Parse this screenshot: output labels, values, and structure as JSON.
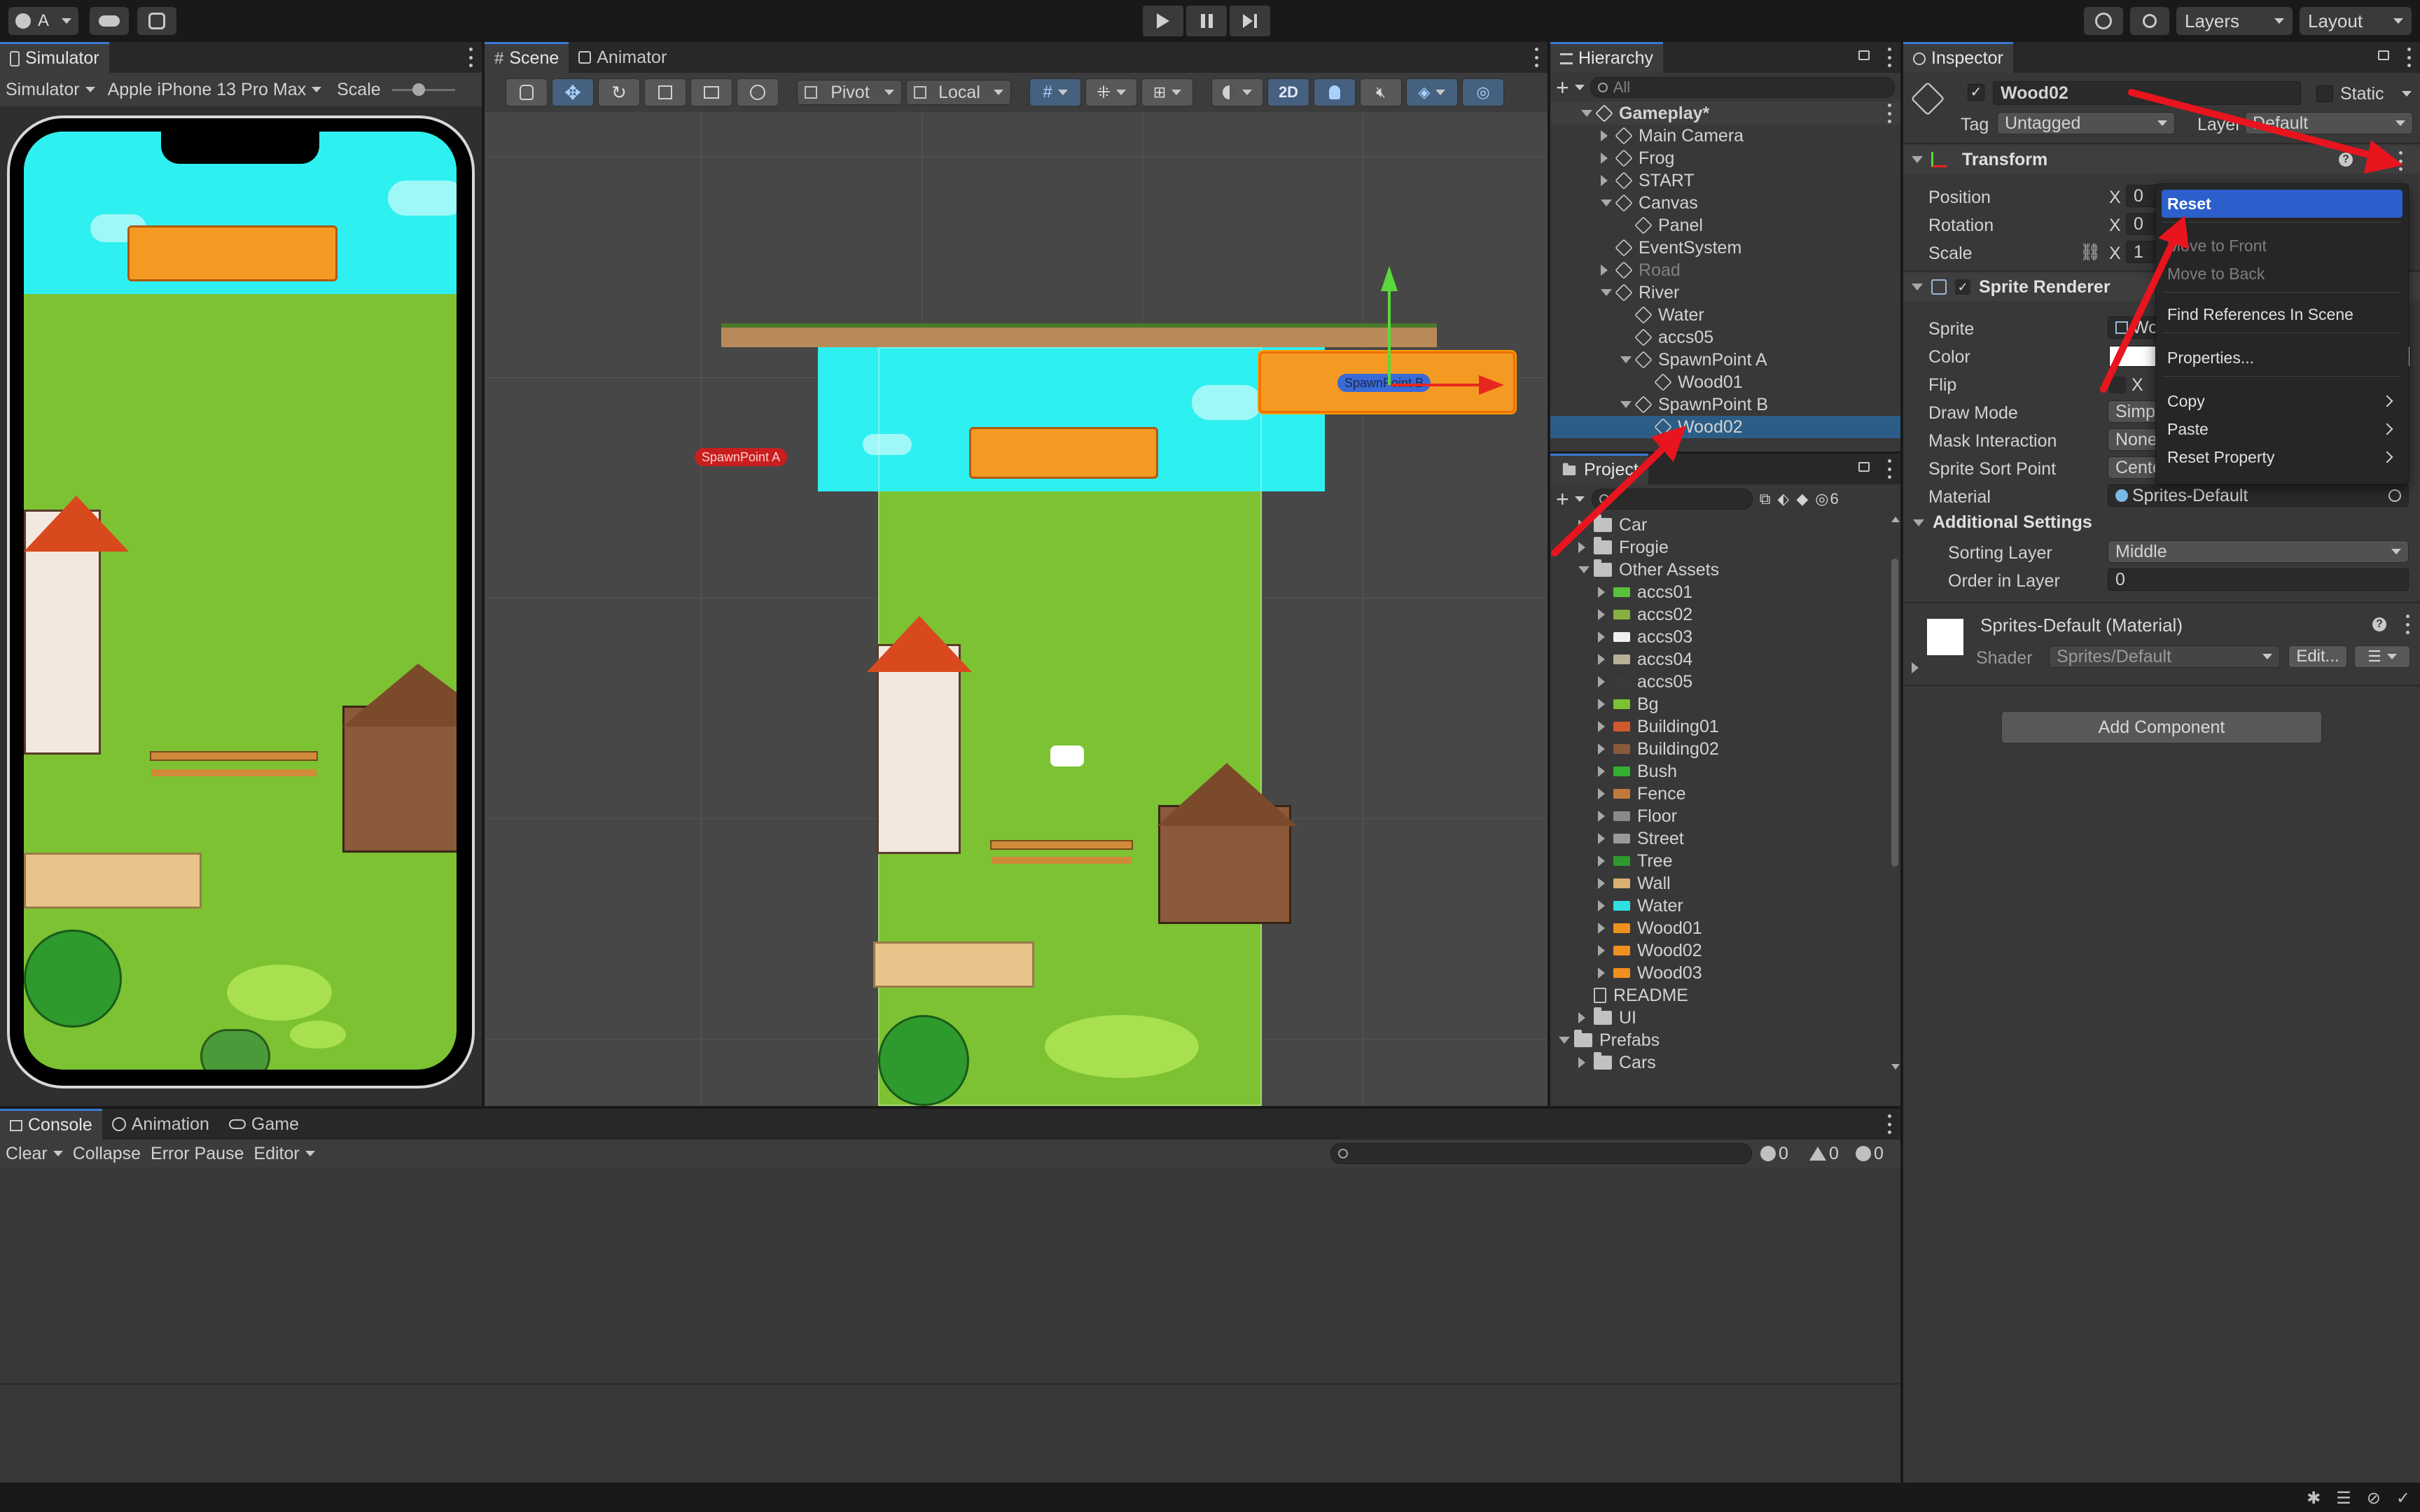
{
  "toolbar": {
    "account_label": "A",
    "layers_label": "Layers",
    "layout_label": "Layout"
  },
  "simulator": {
    "tab_label": "Simulator",
    "mode_label": "Simulator",
    "device_label": "Apple iPhone 13 Pro Max",
    "scale_label": "Scale",
    "scale_value": 0.4
  },
  "scene": {
    "tabs": [
      "Scene",
      "Animator"
    ],
    "pivot_label": "Pivot",
    "local_label": "Local",
    "mode_2d_label": "2D",
    "spawn_a_label": "SpawnPoint A",
    "spawn_b_label": "SpawnPoint B"
  },
  "hierarchy": {
    "tab_label": "Hierarchy",
    "search_placeholder": "All",
    "items": [
      {
        "label": "Gameplay*",
        "depth": 0,
        "expand": "open",
        "icon": "scene-icon",
        "bold": true
      },
      {
        "label": "Main Camera",
        "depth": 1,
        "expand": "closed",
        "icon": "gameobject-icon"
      },
      {
        "label": "Frog",
        "depth": 1,
        "expand": "closed",
        "icon": "gameobject-icon"
      },
      {
        "label": "START",
        "depth": 1,
        "expand": "closed",
        "icon": "gameobject-icon"
      },
      {
        "label": "Canvas",
        "depth": 1,
        "expand": "open",
        "icon": "gameobject-icon"
      },
      {
        "label": "Panel",
        "depth": 2,
        "expand": "none",
        "icon": "gameobject-icon"
      },
      {
        "label": "EventSystem",
        "depth": 1,
        "expand": "none",
        "icon": "gameobject-icon"
      },
      {
        "label": "Road",
        "depth": 1,
        "expand": "closed",
        "icon": "gameobject-icon",
        "dim": true
      },
      {
        "label": "River",
        "depth": 1,
        "expand": "open",
        "icon": "gameobject-icon"
      },
      {
        "label": "Water",
        "depth": 2,
        "expand": "none",
        "icon": "gameobject-icon"
      },
      {
        "label": "accs05",
        "depth": 2,
        "expand": "none",
        "icon": "gameobject-icon"
      },
      {
        "label": "SpawnPoint A",
        "depth": 2,
        "expand": "open",
        "icon": "gameobject-icon"
      },
      {
        "label": "Wood01",
        "depth": 3,
        "expand": "none",
        "icon": "gameobject-icon"
      },
      {
        "label": "SpawnPoint B",
        "depth": 2,
        "expand": "open",
        "icon": "gameobject-icon"
      },
      {
        "label": "Wood02",
        "depth": 3,
        "expand": "none",
        "icon": "gameobject-icon",
        "selected": true
      }
    ]
  },
  "project": {
    "tab_label": "Project",
    "badge_count": "6",
    "items": [
      {
        "label": "Car",
        "depth": 0,
        "expand": "closed",
        "icon": "folder-icon"
      },
      {
        "label": "Frogie",
        "depth": 0,
        "expand": "closed",
        "icon": "folder-icon"
      },
      {
        "label": "Other Assets",
        "depth": 0,
        "expand": "open",
        "icon": "folder-icon"
      },
      {
        "label": "accs01",
        "depth": 1,
        "expand": "closed",
        "icon": "accs01-sprite-icon",
        "color": "#57c23a"
      },
      {
        "label": "accs02",
        "depth": 1,
        "expand": "closed",
        "icon": "accs02-sprite-icon",
        "color": "#88b040"
      },
      {
        "label": "accs03",
        "depth": 1,
        "expand": "closed",
        "icon": "accs03-sprite-icon",
        "color": "#f0f0f0"
      },
      {
        "label": "accs04",
        "depth": 1,
        "expand": "closed",
        "icon": "accs04-sprite-icon",
        "color": "#b8b098"
      },
      {
        "label": "accs05",
        "depth": 1,
        "expand": "closed",
        "icon": "accs05-sprite-icon",
        "color": "#3a3a3a"
      },
      {
        "label": "Bg",
        "depth": 1,
        "expand": "closed",
        "icon": "bg-sprite-icon",
        "color": "#7cc232"
      },
      {
        "label": "Building01",
        "depth": 1,
        "expand": "closed",
        "icon": "building01-sprite-icon",
        "color": "#d05a2e"
      },
      {
        "label": "Building02",
        "depth": 1,
        "expand": "closed",
        "icon": "building02-sprite-icon",
        "color": "#8a5a3a"
      },
      {
        "label": "Bush",
        "depth": 1,
        "expand": "closed",
        "icon": "bush-sprite-icon",
        "color": "#34b030"
      },
      {
        "label": "Fence",
        "depth": 1,
        "expand": "closed",
        "icon": "fence-sprite-icon",
        "color": "#c07a3a"
      },
      {
        "label": "Floor",
        "depth": 1,
        "expand": "closed",
        "icon": "floor-sprite-icon",
        "color": "#8a8a8a"
      },
      {
        "label": "Street",
        "depth": 1,
        "expand": "closed",
        "icon": "street-sprite-icon",
        "color": "#9a9a9a"
      },
      {
        "label": "Tree",
        "depth": 1,
        "expand": "closed",
        "icon": "tree-sprite-icon",
        "color": "#2e9a2e"
      },
      {
        "label": "Wall",
        "depth": 1,
        "expand": "closed",
        "icon": "wall-sprite-icon",
        "color": "#d8b070"
      },
      {
        "label": "Water",
        "depth": 1,
        "expand": "closed",
        "icon": "water-sprite-icon",
        "color": "#2fe0e0"
      },
      {
        "label": "Wood01",
        "depth": 1,
        "expand": "closed",
        "icon": "wood01-sprite-icon",
        "color": "#f0901e"
      },
      {
        "label": "Wood02",
        "depth": 1,
        "expand": "closed",
        "icon": "wood02-sprite-icon",
        "color": "#f0901e"
      },
      {
        "label": "Wood03",
        "depth": 1,
        "expand": "closed",
        "icon": "wood03-sprite-icon",
        "color": "#f0901e"
      },
      {
        "label": "README",
        "depth": 0,
        "expand": "none",
        "icon": "readme-icon"
      },
      {
        "label": "UI",
        "depth": 0,
        "expand": "closed",
        "icon": "folder-icon"
      },
      {
        "label": "Prefabs",
        "depth": -1,
        "expand": "open",
        "icon": "folder-icon"
      },
      {
        "label": "Cars",
        "depth": 0,
        "expand": "closed",
        "icon": "folder-icon"
      }
    ]
  },
  "inspector": {
    "tab_label": "Inspector",
    "object_name": "Wood02",
    "static_label": "Static",
    "tag_label": "Tag",
    "tag_value": "Untagged",
    "layer_label": "Layer",
    "layer_value": "Default",
    "transform": {
      "title": "Transform",
      "position_label": "Position",
      "rotation_label": "Rotation",
      "scale_label": "Scale",
      "x_label": "X",
      "position_x": "0",
      "rotation_x": "0",
      "scale_x": "1"
    },
    "sprite_renderer": {
      "title": "Sprite Renderer",
      "sprite_label": "Sprite",
      "sprite_value": "Wo",
      "color_label": "Color",
      "flip_label": "Flip",
      "flip_x_label": "X",
      "draw_mode_label": "Draw Mode",
      "draw_mode_value": "Simp",
      "mask_label": "Mask Interaction",
      "mask_value": "None",
      "sort_point_label": "Sprite Sort Point",
      "sort_point_value": "Cente",
      "material_label": "Material",
      "material_value": "Sprites-Default"
    },
    "additional": {
      "title": "Additional Settings",
      "sorting_layer_label": "Sorting Layer",
      "sorting_layer_value": "Middle",
      "order_label": "Order in Layer",
      "order_value": "0"
    },
    "material": {
      "title": "Sprites-Default (Material)",
      "shader_label": "Shader",
      "shader_value": "Sprites/Default",
      "edit_label": "Edit..."
    },
    "add_component_label": "Add Component"
  },
  "context_menu": {
    "items": [
      {
        "label": "Reset",
        "state": "highlighted"
      },
      {
        "label": "Move to Front",
        "state": "disabled"
      },
      {
        "label": "Move to Back",
        "state": "disabled"
      },
      {
        "label": "Find References In Scene",
        "state": "normal"
      },
      {
        "label": "Properties...",
        "state": "normal"
      },
      {
        "label": "Copy",
        "state": "submenu"
      },
      {
        "label": "Paste",
        "state": "submenu"
      },
      {
        "label": "Reset Property",
        "state": "submenu"
      }
    ]
  },
  "console": {
    "tabs": [
      "Console",
      "Animation",
      "Game"
    ],
    "clear_label": "Clear",
    "collapse_label": "Collapse",
    "error_pause_label": "Error Pause",
    "editor_label": "Editor",
    "log_count": "0",
    "warning_count": "0",
    "error_count": "0"
  },
  "colors": {
    "accent": "#2c5fcc",
    "selection": "#2c5d87",
    "water": "#2ff0f0",
    "grass": "#7cc232",
    "wood": "#f0901e",
    "arrow": "#e8141e"
  }
}
